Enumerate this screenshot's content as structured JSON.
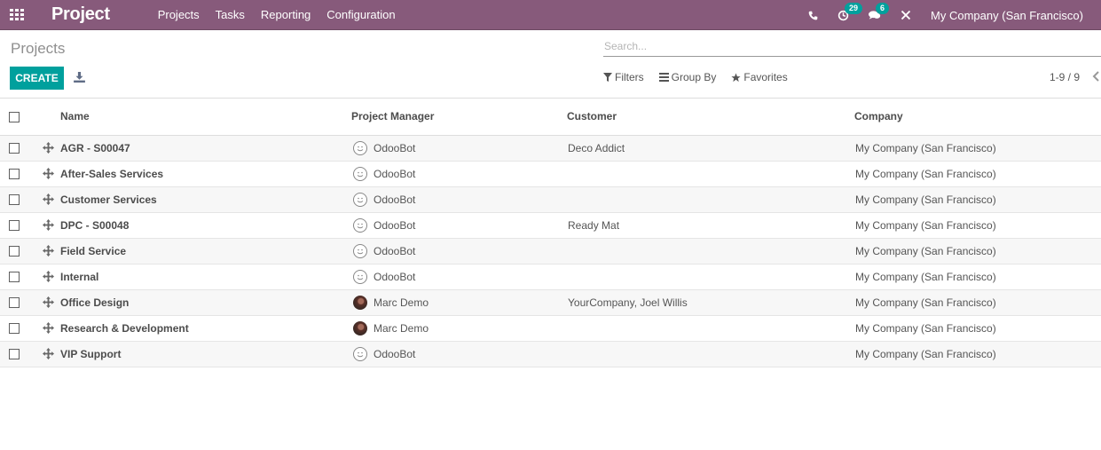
{
  "navbar": {
    "brand": "Project",
    "menu": [
      "Projects",
      "Tasks",
      "Reporting",
      "Configuration"
    ],
    "activity_count": "29",
    "message_count": "6",
    "company": "My Company (San Francisco)",
    "accent_color": "#875a7b",
    "badge_color": "#00a09d"
  },
  "control_panel": {
    "breadcrumb": "Projects",
    "create_label": "CREATE",
    "search_placeholder": "Search...",
    "filters_label": "Filters",
    "group_by_label": "Group By",
    "favorites_label": "Favorites",
    "pager": "1-9 / 9"
  },
  "table": {
    "headers": {
      "name": "Name",
      "project_manager": "Project Manager",
      "customer": "Customer",
      "company": "Company"
    },
    "rows": [
      {
        "name": "AGR - S00047",
        "manager": "OdooBot",
        "manager_avatar": "bot",
        "customer": "Deco Addict",
        "company": "My Company (San Francisco)"
      },
      {
        "name": "After-Sales Services",
        "manager": "OdooBot",
        "manager_avatar": "bot",
        "customer": "",
        "company": "My Company (San Francisco)"
      },
      {
        "name": "Customer Services",
        "manager": "OdooBot",
        "manager_avatar": "bot",
        "customer": "",
        "company": "My Company (San Francisco)"
      },
      {
        "name": "DPC - S00048",
        "manager": "OdooBot",
        "manager_avatar": "bot",
        "customer": "Ready Mat",
        "company": "My Company (San Francisco)"
      },
      {
        "name": "Field Service",
        "manager": "OdooBot",
        "manager_avatar": "bot",
        "customer": "",
        "company": "My Company (San Francisco)"
      },
      {
        "name": "Internal",
        "manager": "OdooBot",
        "manager_avatar": "bot",
        "customer": "",
        "company": "My Company (San Francisco)"
      },
      {
        "name": "Office Design",
        "manager": "Marc Demo",
        "manager_avatar": "human",
        "customer": "YourCompany, Joel Willis",
        "company": "My Company (San Francisco)"
      },
      {
        "name": "Research & Development",
        "manager": "Marc Demo",
        "manager_avatar": "human",
        "customer": "",
        "company": "My Company (San Francisco)"
      },
      {
        "name": "VIP Support",
        "manager": "OdooBot",
        "manager_avatar": "bot",
        "customer": "",
        "company": "My Company (San Francisco)"
      }
    ]
  }
}
